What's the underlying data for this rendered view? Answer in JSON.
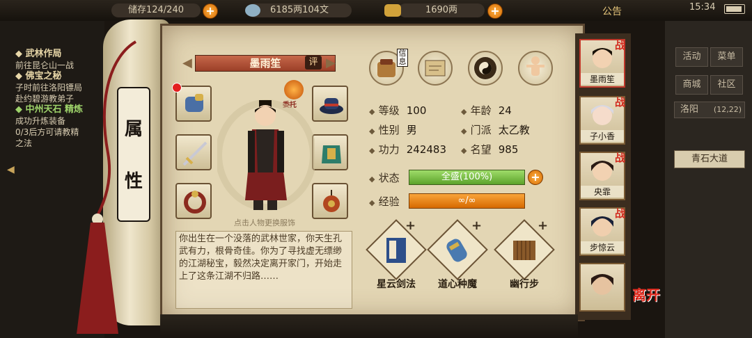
{
  "topbar": {
    "capacity": "储存124/240",
    "money": "6185两104文",
    "gold": "1690两",
    "announcement": "公告",
    "time": "15:34"
  },
  "quests": [
    {
      "title": "◆ 武林作局",
      "lines": [
        "前往昆仑山一战"
      ]
    },
    {
      "title": "◆ 佛宝之秘",
      "lines": [
        "子时前往洛阳镖局",
        "赴约碧游教弟子"
      ]
    },
    {
      "title": "◆ 中州天石 精炼",
      "lines": [
        "成功升炼装备",
        "0/3后方可请教精",
        "之法"
      ],
      "green": true
    }
  ],
  "right_menu": {
    "buttons": [
      "活动",
      "菜单",
      "商城",
      "社区"
    ],
    "location": "洛阳",
    "location_coords": "(12,22)",
    "road": "青石大道"
  },
  "scroll": {
    "tab_char1": "属",
    "tab_char2": "性"
  },
  "character": {
    "name": "墨雨笙",
    "ping": "评",
    "entrust": "委托",
    "caption": "点击人物更换服饰",
    "description": "你出生在一个没落的武林世家，你天生孔武有力，根骨奇佳。你为了寻找虚无缥缈的江湖秘宝，毅然决定离开家门，开始走上了这条江湖不归路……"
  },
  "top_icons": [
    {
      "icon": "letter-bag-icon",
      "label": "信息"
    },
    {
      "icon": "map-scroll-icon",
      "label": ""
    },
    {
      "icon": "bagua-icon",
      "label": ""
    },
    {
      "icon": "meridian-figure-icon",
      "label": ""
    }
  ],
  "stats": {
    "level_label": "等级",
    "level": "100",
    "age_label": "年龄",
    "age": "24",
    "gender_label": "性别",
    "gender": "男",
    "sect_label": "门派",
    "sect": "太乙教",
    "power_label": "功力",
    "power": "242483",
    "fame_label": "名望",
    "fame": "985",
    "status_label": "状态",
    "status_value": "全盛(100%)",
    "status_fill": 1.0,
    "exp_label": "经验",
    "exp_value": "∞/∞",
    "exp_fill": 1.0
  },
  "skills": [
    {
      "name": "星云剑法",
      "icon": "sword-manual-icon"
    },
    {
      "name": "道心种魔",
      "icon": "scroll-tube-icon"
    },
    {
      "name": "幽行步",
      "icon": "bamboo-slips-icon"
    }
  ],
  "party": [
    {
      "name": "墨雨笙",
      "mark": "战",
      "selected": true
    },
    {
      "name": "子小香",
      "mark": "战"
    },
    {
      "name": "央霏",
      "mark": "战"
    },
    {
      "name": "步惊云",
      "mark": "战"
    },
    {
      "name": "",
      "mark": ""
    }
  ],
  "leave_label": "离开",
  "colors": {
    "paper": "#e3d6b4",
    "status_green": "#5ca32b",
    "exp_orange": "#d66a00",
    "accent_red": "#d22a1e"
  }
}
